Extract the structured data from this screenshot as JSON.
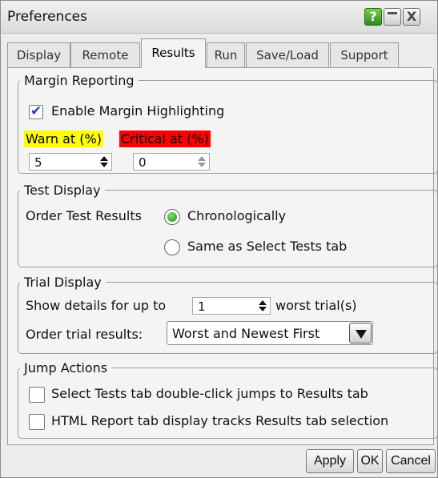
{
  "window": {
    "title": "Preferences",
    "help_label": "?",
    "close_label": "X"
  },
  "tabs": [
    {
      "label": "Display"
    },
    {
      "label": "Remote"
    },
    {
      "label": "Results"
    },
    {
      "label": "Run"
    },
    {
      "label": "Save/Load"
    },
    {
      "label": "Support"
    }
  ],
  "active_tab": "Results",
  "margin_reporting": {
    "legend": "Margin Reporting",
    "enable_label": "Enable Margin Highlighting",
    "enable_checked": true,
    "warn_label": "Warn at (%)",
    "warn_value": "5",
    "critical_label": "Critical at (%)",
    "critical_value": "0"
  },
  "test_display": {
    "legend": "Test Display",
    "order_label": "Order Test Results",
    "options": [
      "Chronologically",
      "Same as Select Tests tab"
    ],
    "selected": "Chronologically"
  },
  "trial_display": {
    "legend": "Trial Display",
    "show_prefix": "Show details for up to",
    "show_value": "1",
    "show_suffix": "worst trial(s)",
    "order_label": "Order trial results:",
    "order_value": "Worst and Newest First"
  },
  "jump_actions": {
    "legend": "Jump Actions",
    "options": [
      {
        "label": "Select Tests tab double-click jumps to Results tab",
        "checked": false
      },
      {
        "label": "HTML Report tab display tracks Results tab selection",
        "checked": false
      }
    ]
  },
  "buttons": {
    "apply": "Apply",
    "ok": "OK",
    "cancel": "Cancel"
  },
  "colors": {
    "warn": "#ffff00",
    "critical": "#ff0000",
    "check": "#1c3fd6",
    "radio_selected": "#1f8a1b"
  }
}
